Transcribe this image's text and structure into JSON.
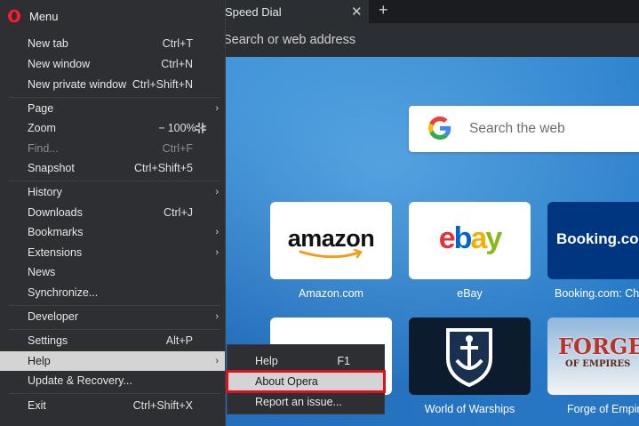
{
  "browser": {
    "tab_title": "Speed Dial",
    "tab_close": "✕",
    "new_tab": "+",
    "address_placeholder": "Search or web address"
  },
  "speed_dial": {
    "search_placeholder": "Search the web",
    "tiles": [
      {
        "label": "Amazon.com",
        "logo": "amazon"
      },
      {
        "label": "eBay",
        "logo": "ebay"
      },
      {
        "label": "Booking.com: Ch",
        "logo": "Booking.co"
      },
      {
        "label": "",
        "logo": ""
      },
      {
        "label": "World of Warships",
        "logo": "warships-emblem"
      },
      {
        "label": "Forge of Empir",
        "logo_line1": "FORGE",
        "logo_line2": "OF EMPIRES"
      }
    ]
  },
  "menu": {
    "title": "Menu",
    "items": {
      "new_tab": {
        "label": "New tab",
        "shortcut": "Ctrl+T"
      },
      "new_window": {
        "label": "New window",
        "shortcut": "Ctrl+N"
      },
      "new_private_window": {
        "label": "New private window",
        "shortcut": "Ctrl+Shift+N"
      },
      "page": {
        "label": "Page"
      },
      "zoom": {
        "label": "Zoom",
        "minus": "−",
        "value": "100%",
        "plus": "+"
      },
      "find": {
        "label": "Find...",
        "shortcut": "Ctrl+F"
      },
      "snapshot": {
        "label": "Snapshot",
        "shortcut": "Ctrl+Shift+5"
      },
      "history": {
        "label": "History"
      },
      "downloads": {
        "label": "Downloads",
        "shortcut": "Ctrl+J"
      },
      "bookmarks": {
        "label": "Bookmarks"
      },
      "extensions": {
        "label": "Extensions"
      },
      "news": {
        "label": "News"
      },
      "synchronize": {
        "label": "Synchronize..."
      },
      "developer": {
        "label": "Developer"
      },
      "settings": {
        "label": "Settings",
        "shortcut": "Alt+P"
      },
      "help": {
        "label": "Help"
      },
      "update_recovery": {
        "label": "Update & Recovery..."
      },
      "exit": {
        "label": "Exit",
        "shortcut": "Ctrl+Shift+X"
      }
    },
    "arrow": "›"
  },
  "help_submenu": {
    "help": {
      "label": "Help",
      "shortcut": "F1"
    },
    "about": {
      "label": "About Opera"
    },
    "report": {
      "label": "Report an issue..."
    }
  },
  "colors": {
    "menu_bg": "#2d2f33",
    "selection": "#d4d4d4",
    "highlight_box": "#e0101a",
    "opera_red": "#ff1b2d",
    "ebay": [
      "#e53238",
      "#0064d2",
      "#f5af02",
      "#86b817"
    ],
    "booking_blue": "#003580",
    "warships_dark": "#0d1b2e"
  }
}
